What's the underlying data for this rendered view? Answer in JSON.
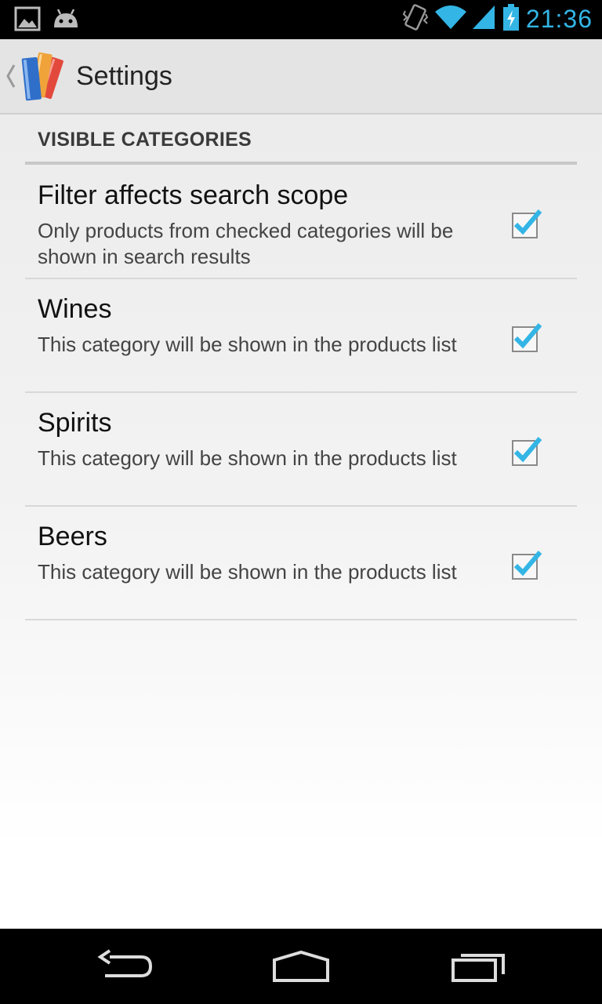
{
  "status_bar": {
    "time": "21:36",
    "icons": [
      "gallery-icon",
      "android-icon",
      "vibrate-icon",
      "wifi-icon",
      "signal-icon",
      "battery-charging-icon"
    ]
  },
  "action_bar": {
    "title": "Settings",
    "icon": "books-app-icon"
  },
  "section": {
    "header": "VISIBLE CATEGORIES"
  },
  "preferences": [
    {
      "title": "Filter affects search scope",
      "summary": "Only products from checked categories will be shown in search results",
      "checked": true
    },
    {
      "title": "Wines",
      "summary": "This category will be shown in the products list",
      "checked": true
    },
    {
      "title": "Spirits",
      "summary": "This category will be shown in the products list",
      "checked": true
    },
    {
      "title": "Beers",
      "summary": "This category will be shown in the products list",
      "checked": true
    }
  ],
  "colors": {
    "accent": "#33b5e5",
    "action_bar_bg": "#e4e4e4",
    "status_bar_bg": "#000000"
  },
  "nav_bar": {
    "buttons": [
      "back-icon",
      "home-icon",
      "recents-icon"
    ]
  }
}
